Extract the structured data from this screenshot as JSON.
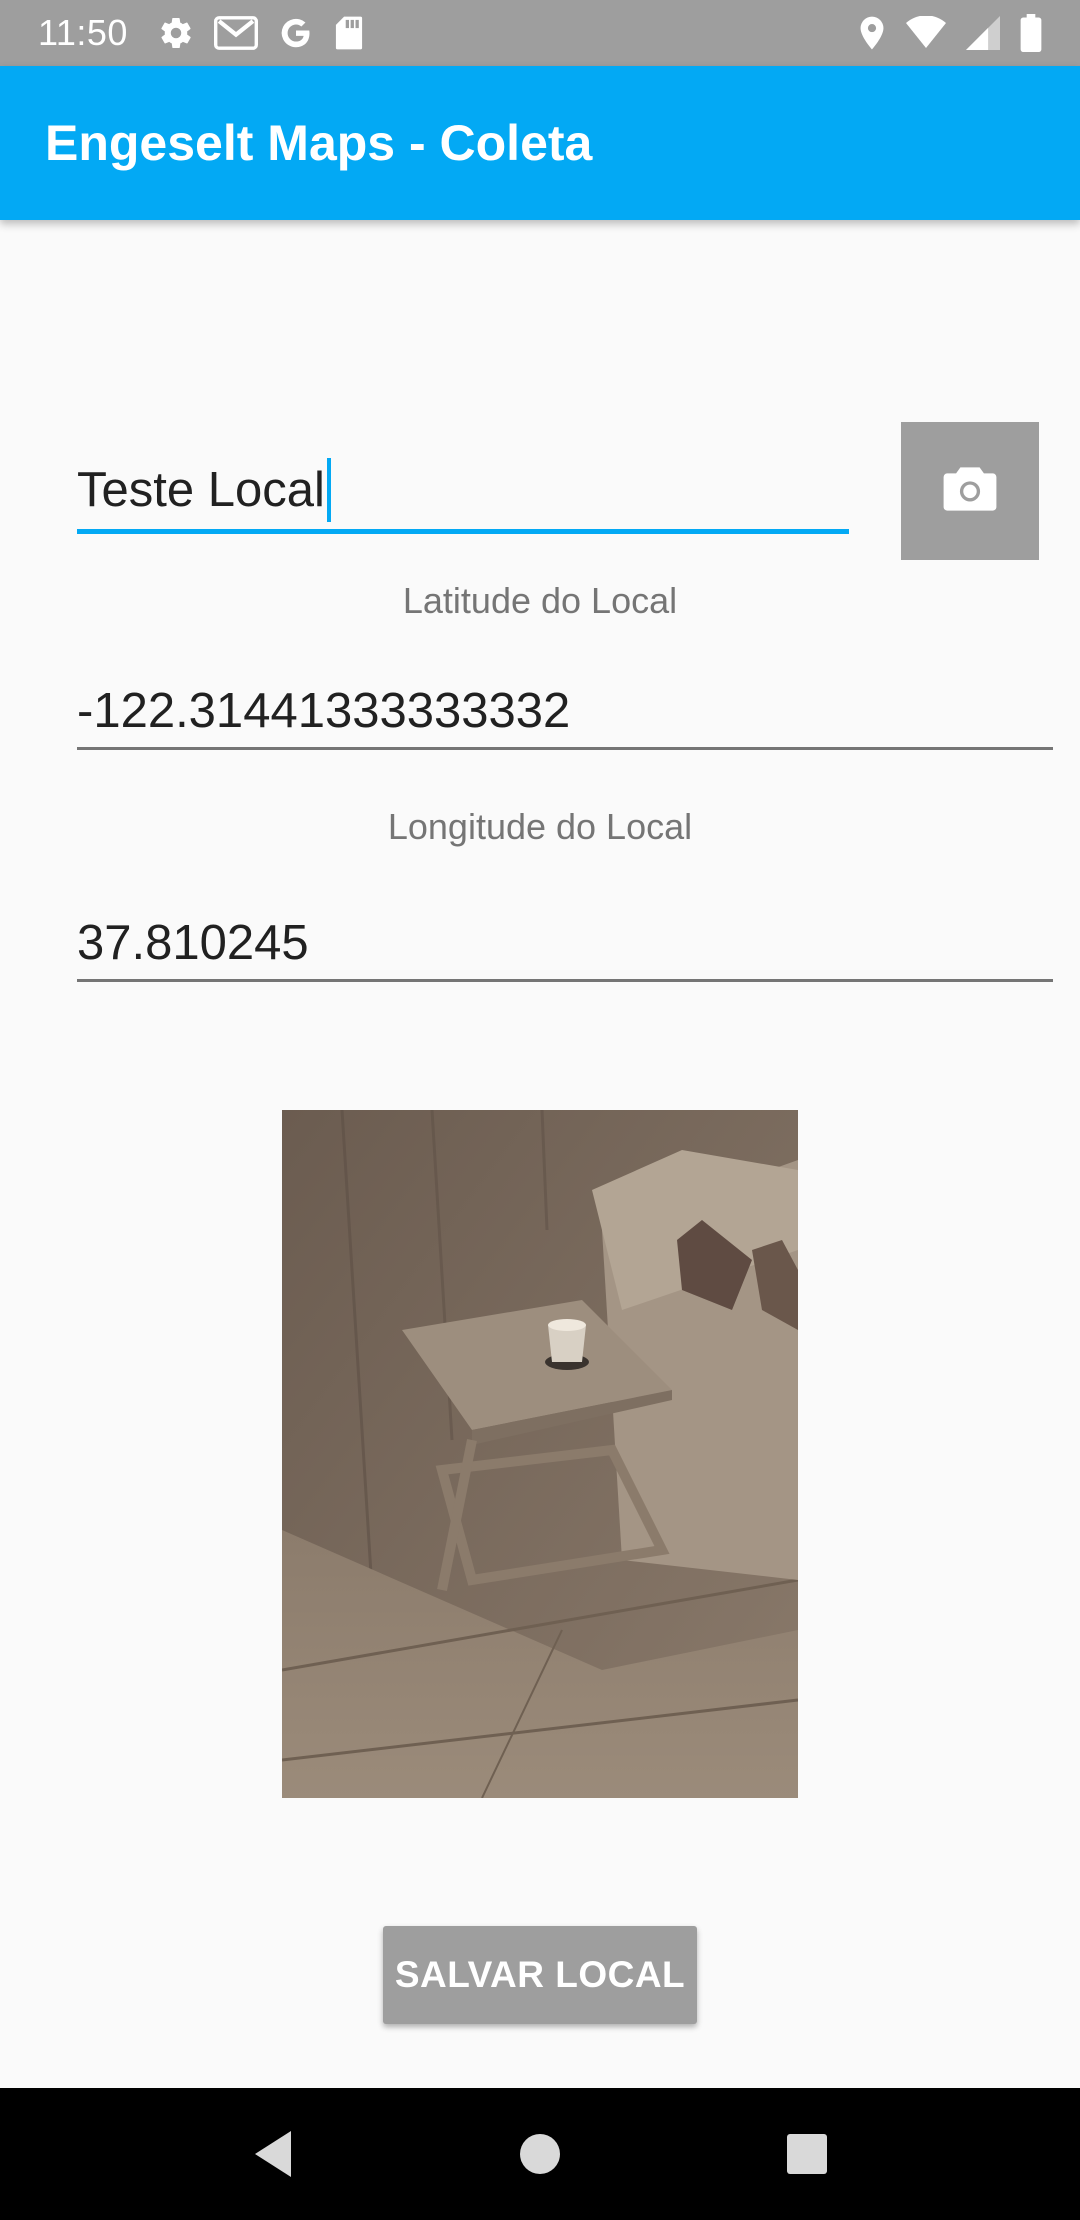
{
  "status_bar": {
    "time": "11:50",
    "left_icons": [
      "gear-icon",
      "gmail-icon",
      "google-icon",
      "sd-card-icon"
    ],
    "right_icons": [
      "location-icon",
      "wifi-icon",
      "signal-icon",
      "battery-icon"
    ]
  },
  "app_bar": {
    "title": "Engeselt Maps - Coleta"
  },
  "form": {
    "name_value": "Teste Local",
    "latitude_label": "Latitude do Local",
    "latitude_value": "-122.31441333333332",
    "longitude_label": "Longitude do Local",
    "longitude_value": "37.810245"
  },
  "camera_button": {
    "icon": "camera-icon"
  },
  "save_button": {
    "label": "SALVAR LOCAL"
  },
  "nav_bar": {
    "items": [
      "back-icon",
      "home-icon",
      "recents-icon"
    ]
  },
  "colors": {
    "primary": "#03a9f4",
    "button_gray": "#9e9e9e",
    "background": "#fafafa"
  }
}
